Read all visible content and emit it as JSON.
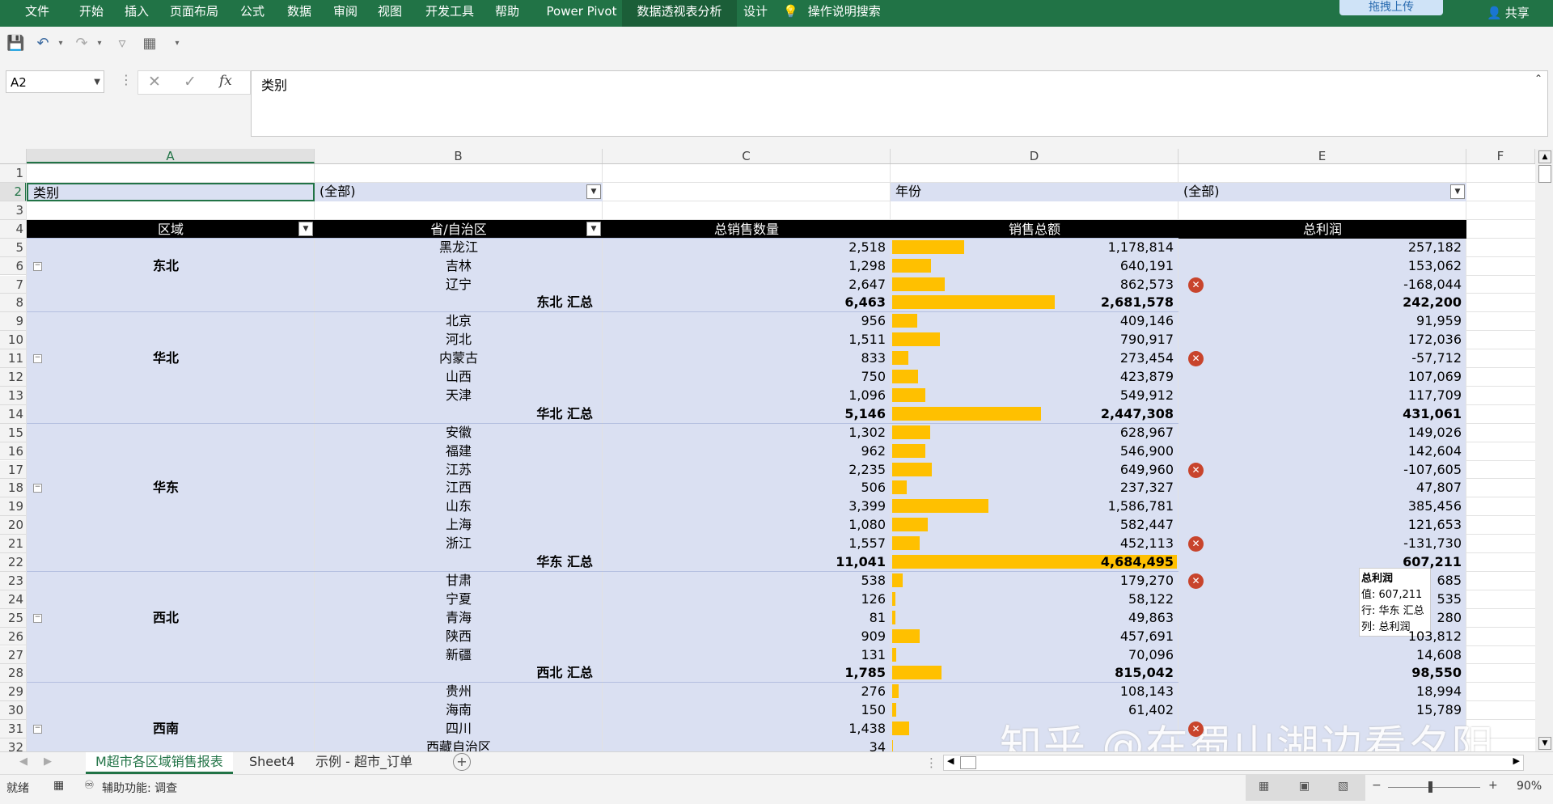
{
  "ribbon": {
    "tabs": [
      "文件",
      "开始",
      "插入",
      "页面布局",
      "公式",
      "数据",
      "审阅",
      "视图",
      "开发工具",
      "帮助",
      "Power Pivot",
      "数据透视表分析",
      "设计"
    ],
    "active_tab": "数据透视表分析",
    "search_label": "操作说明搜索",
    "upload_label": "拖拽上传",
    "share_label": "共享"
  },
  "qat": {
    "icons": [
      "save-icon",
      "undo-icon",
      "redo-icon",
      "filter-icon",
      "pivot-icon",
      "customize-icon"
    ]
  },
  "formula_bar": {
    "name_box": "A2",
    "formula": "类别",
    "fx_label": "fx"
  },
  "columns": [
    "A",
    "B",
    "C",
    "D",
    "E",
    "F"
  ],
  "rows": [
    "1",
    "2",
    "3",
    "4",
    "5",
    "6",
    "7",
    "8",
    "9",
    "10",
    "11",
    "12",
    "13",
    "14",
    "15",
    "16",
    "17",
    "18",
    "19",
    "20",
    "21",
    "22",
    "23",
    "24",
    "25",
    "26",
    "27",
    "28",
    "29",
    "30",
    "31",
    "32"
  ],
  "filters": {
    "category_label": "类别",
    "category_value": "(全部)",
    "year_label": "年份",
    "year_value": "(全部)"
  },
  "pivot_headers": [
    "区域",
    "省/自治区",
    "总销售数量",
    "销售总额",
    "总利润"
  ],
  "pivot_rows": [
    {
      "region": "",
      "province": "黑龙江",
      "qty": "2,518",
      "sales": "1,178,814",
      "profit": "257,182",
      "bar": 0.252,
      "flag": false,
      "subtotal": false
    },
    {
      "region": "东北",
      "province": "吉林",
      "qty": "1,298",
      "sales": "640,191",
      "profit": "153,062",
      "bar": 0.137,
      "flag": false,
      "subtotal": false
    },
    {
      "region": "",
      "province": "辽宁",
      "qty": "2,647",
      "sales": "862,573",
      "profit": "-168,044",
      "bar": 0.184,
      "flag": true,
      "subtotal": false
    },
    {
      "region": "",
      "province": "东北 汇总",
      "qty": "6,463",
      "sales": "2,681,578",
      "profit": "242,200",
      "bar": 0.572,
      "flag": false,
      "subtotal": true
    },
    {
      "region": "",
      "province": "北京",
      "qty": "956",
      "sales": "409,146",
      "profit": "91,959",
      "bar": 0.087,
      "flag": false,
      "subtotal": false
    },
    {
      "region": "",
      "province": "河北",
      "qty": "1,511",
      "sales": "790,917",
      "profit": "172,036",
      "bar": 0.169,
      "flag": false,
      "subtotal": false
    },
    {
      "region": "华北",
      "province": "内蒙古",
      "qty": "833",
      "sales": "273,454",
      "profit": "-57,712",
      "bar": 0.058,
      "flag": true,
      "subtotal": false
    },
    {
      "region": "",
      "province": "山西",
      "qty": "750",
      "sales": "423,879",
      "profit": "107,069",
      "bar": 0.09,
      "flag": false,
      "subtotal": false
    },
    {
      "region": "",
      "province": "天津",
      "qty": "1,096",
      "sales": "549,912",
      "profit": "117,709",
      "bar": 0.117,
      "flag": false,
      "subtotal": false
    },
    {
      "region": "",
      "province": "华北 汇总",
      "qty": "5,146",
      "sales": "2,447,308",
      "profit": "431,061",
      "bar": 0.522,
      "flag": false,
      "subtotal": true
    },
    {
      "region": "",
      "province": "安徽",
      "qty": "1,302",
      "sales": "628,967",
      "profit": "149,026",
      "bar": 0.134,
      "flag": false,
      "subtotal": false
    },
    {
      "region": "",
      "province": "福建",
      "qty": "962",
      "sales": "546,900",
      "profit": "142,604",
      "bar": 0.117,
      "flag": false,
      "subtotal": false
    },
    {
      "region": "",
      "province": "江苏",
      "qty": "2,235",
      "sales": "649,960",
      "profit": "-107,605",
      "bar": 0.139,
      "flag": true,
      "subtotal": false
    },
    {
      "region": "华东",
      "province": "江西",
      "qty": "506",
      "sales": "237,327",
      "profit": "47,807",
      "bar": 0.051,
      "flag": false,
      "subtotal": false
    },
    {
      "region": "",
      "province": "山东",
      "qty": "3,399",
      "sales": "1,586,781",
      "profit": "385,456",
      "bar": 0.339,
      "flag": false,
      "subtotal": false
    },
    {
      "region": "",
      "province": "上海",
      "qty": "1,080",
      "sales": "582,447",
      "profit": "121,653",
      "bar": 0.124,
      "flag": false,
      "subtotal": false
    },
    {
      "region": "",
      "province": "浙江",
      "qty": "1,557",
      "sales": "452,113",
      "profit": "-131,730",
      "bar": 0.097,
      "flag": true,
      "subtotal": false
    },
    {
      "region": "",
      "province": "华东 汇总",
      "qty": "11,041",
      "sales": "4,684,495",
      "profit": "607,211",
      "bar": 1.0,
      "flag": false,
      "subtotal": true
    },
    {
      "region": "",
      "province": "甘肃",
      "qty": "538",
      "sales": "179,270",
      "profit": "685",
      "bar": 0.038,
      "flag": true,
      "subtotal": false
    },
    {
      "region": "",
      "province": "宁夏",
      "qty": "126",
      "sales": "58,122",
      "profit": "535",
      "bar": 0.012,
      "flag": false,
      "subtotal": false
    },
    {
      "region": "西北",
      "province": "青海",
      "qty": "81",
      "sales": "49,863",
      "profit": "280",
      "bar": 0.011,
      "flag": false,
      "subtotal": false
    },
    {
      "region": "",
      "province": "陕西",
      "qty": "909",
      "sales": "457,691",
      "profit": "103,812",
      "bar": 0.098,
      "flag": false,
      "subtotal": false
    },
    {
      "region": "",
      "province": "新疆",
      "qty": "131",
      "sales": "70,096",
      "profit": "14,608",
      "bar": 0.015,
      "flag": false,
      "subtotal": false
    },
    {
      "region": "",
      "province": "西北 汇总",
      "qty": "1,785",
      "sales": "815,042",
      "profit": "98,550",
      "bar": 0.174,
      "flag": false,
      "subtotal": true
    },
    {
      "region": "",
      "province": "贵州",
      "qty": "276",
      "sales": "108,143",
      "profit": "18,994",
      "bar": 0.023,
      "flag": false,
      "subtotal": false
    },
    {
      "region": "",
      "province": "海南",
      "qty": "150",
      "sales": "61,402",
      "profit": "15,789",
      "bar": 0.013,
      "flag": false,
      "subtotal": false
    },
    {
      "region": "西南",
      "province": "四川",
      "qty": "1,438",
      "sales": "",
      "profit": "",
      "bar": 0.06,
      "flag": true,
      "subtotal": false
    },
    {
      "region": "",
      "province": "西藏自治区",
      "qty": "34",
      "sales": "",
      "profit": "",
      "bar": 0.003,
      "flag": false,
      "subtotal": false
    }
  ],
  "tooltip": {
    "title": "总利润",
    "value": "值: 607,211",
    "row": "行: 华东 汇总",
    "col": "列: 总利润"
  },
  "sheet_tabs": [
    "M超市各区域销售报表",
    "Sheet4",
    "示例 - 超市_订单"
  ],
  "active_sheet": "M超市各区域销售报表",
  "status": {
    "ready": "就绪",
    "accessibility": "辅助功能: 调查",
    "zoom": "90%"
  },
  "watermark": "知乎 @在蜀山湖边看夕阳",
  "colors": {
    "ribbon": "#217346",
    "pivot_bg": "#dae0f2",
    "databar": "#ffc000",
    "flag": "#c8442c"
  }
}
